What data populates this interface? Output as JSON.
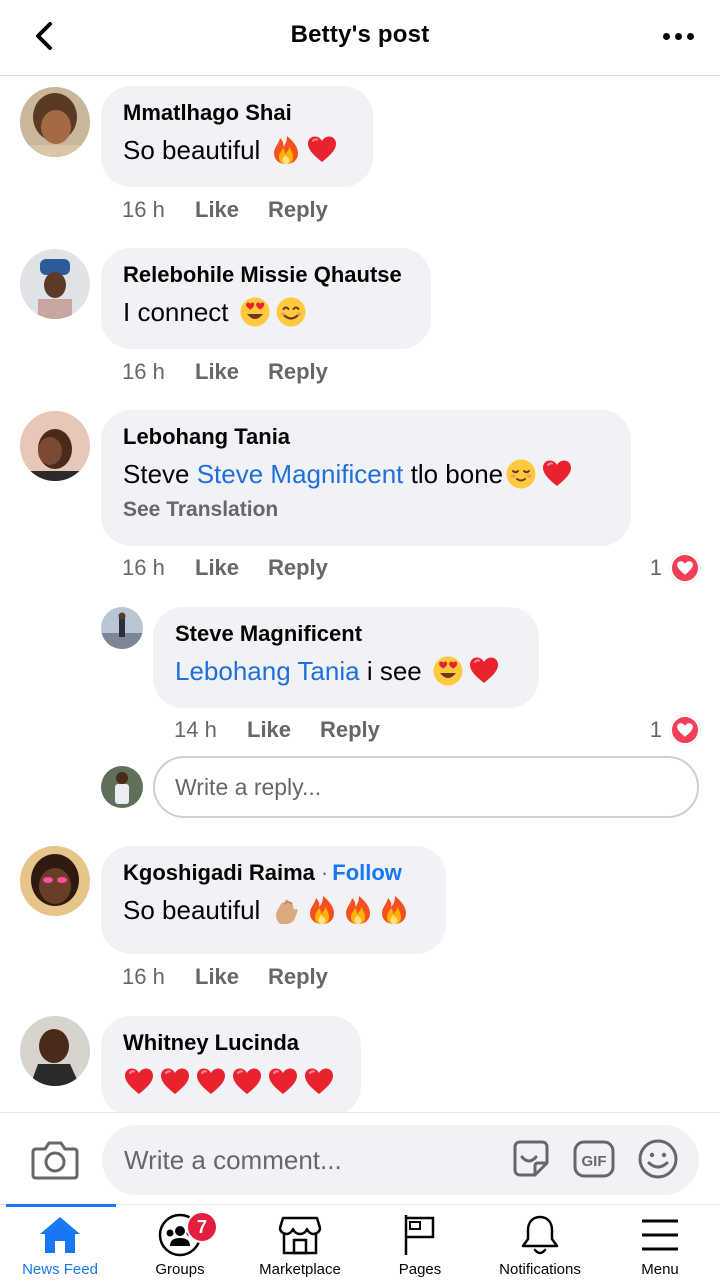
{
  "header": {
    "title": "Betty's post"
  },
  "comments": [
    {
      "author": "Mmatlhago Shai",
      "text": "So beautiful",
      "emojis": [
        "fire",
        "heart"
      ],
      "time": "16 h",
      "like": "Like",
      "reply": "Reply"
    },
    {
      "author": "Relebohile Missie Qhautse",
      "text": "I connect",
      "emojis": [
        "heart-eyes",
        "smile"
      ],
      "time": "16 h",
      "like": "Like",
      "reply": "Reply"
    },
    {
      "author": "Lebohang Tania",
      "text_prefix": "Steve ",
      "mention": "Steve Magnificent",
      "text_suffix": " tlo bone",
      "emojis": [
        "relieved",
        "heart"
      ],
      "see_translation": "See Translation",
      "time": "16 h",
      "like": "Like",
      "reply": "Reply",
      "reactions": "1",
      "replies": [
        {
          "author": "Steve Magnificent",
          "mention": "Lebohang Tania",
          "text": " i see",
          "emojis": [
            "heart-eyes",
            "heart"
          ],
          "time": "14 h",
          "like": "Like",
          "reply": "Reply",
          "reactions": "1"
        }
      ]
    },
    {
      "author": "Kgoshigadi Raima",
      "follow": "Follow",
      "text": "So beautiful",
      "emojis": [
        "pinch",
        "fire",
        "fire",
        "fire"
      ],
      "time": "16 h",
      "like": "Like",
      "reply": "Reply"
    },
    {
      "author": "Whitney Lucinda",
      "emojis": [
        "heart",
        "heart",
        "heart",
        "heart",
        "heart",
        "heart"
      ]
    }
  ],
  "reply_box": {
    "placeholder": "Write a reply..."
  },
  "composer": {
    "placeholder": "Write a comment..."
  },
  "nav": {
    "items": [
      {
        "label": "News Feed",
        "icon": "home-icon",
        "active": true
      },
      {
        "label": "Groups",
        "icon": "groups-icon",
        "badge": "7"
      },
      {
        "label": "Marketplace",
        "icon": "marketplace-icon"
      },
      {
        "label": "Pages",
        "icon": "flag-icon"
      },
      {
        "label": "Notifications",
        "icon": "bell-icon"
      },
      {
        "label": "Menu",
        "icon": "menu-icon"
      }
    ]
  },
  "colors": {
    "accent": "#1877f2",
    "mention": "#216fdb",
    "bubble": "#f0f2f5",
    "secondary_text": "#65676b",
    "badge": "#e41e3f",
    "heart": "#f33e58"
  }
}
